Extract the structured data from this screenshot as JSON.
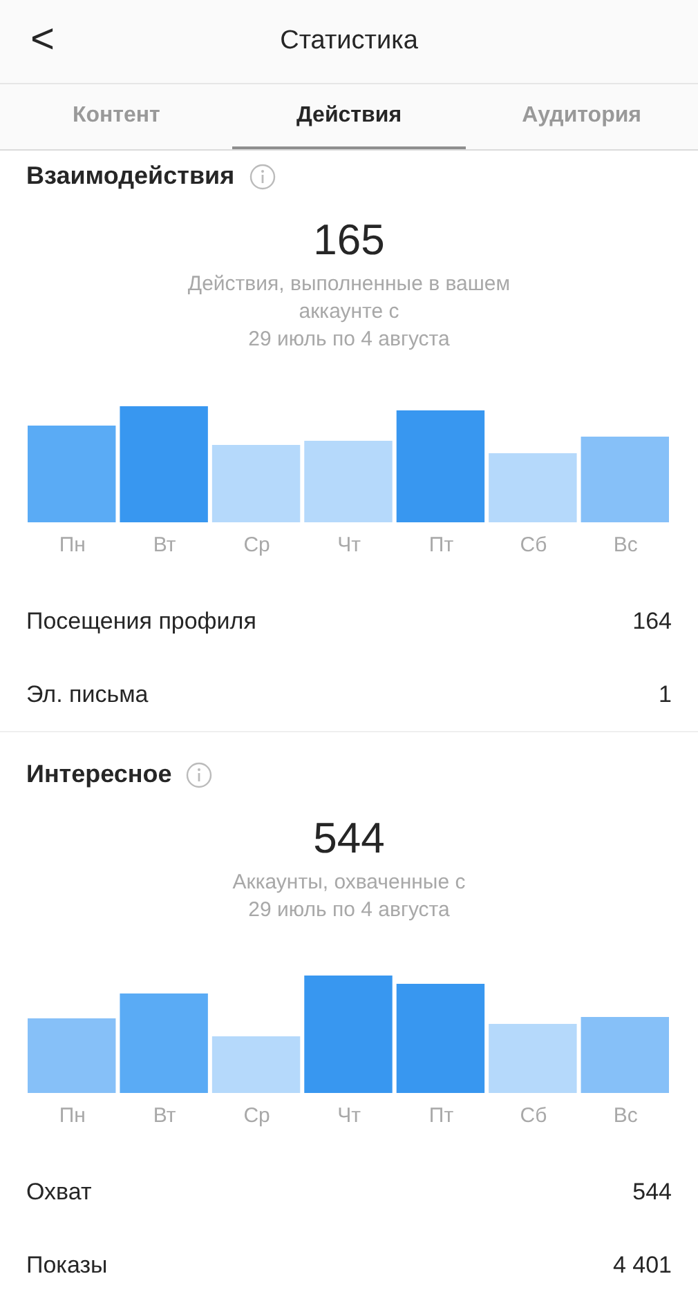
{
  "header": {
    "back": "<",
    "title": "Статистика"
  },
  "tabs": [
    {
      "label": "Контент",
      "selected": false
    },
    {
      "label": "Действия",
      "selected": true
    },
    {
      "label": "Аудитория",
      "selected": false
    }
  ],
  "sections": [
    {
      "title": "Взаимодействия",
      "total": "165",
      "description": [
        "Действия, выполненные в вашем",
        "аккаунте с",
        "29 июль по 4 августа"
      ],
      "days": [
        "Пн",
        "Вт",
        "Ср",
        "Чт",
        "Пт",
        "Сб",
        "Вс"
      ],
      "rows": [
        {
          "label": "Посещения профиля",
          "value": "164"
        },
        {
          "label": "Эл. письма",
          "value": "1"
        }
      ]
    },
    {
      "title": "Интересное",
      "total": "544",
      "description": [
        "Аккаунты, охваченные с",
        "29 июль по 4 августа"
      ],
      "days": [
        "Пн",
        "Вт",
        "Ср",
        "Чт",
        "Пт",
        "Сб",
        "Вс"
      ],
      "rows": [
        {
          "label": "Охват",
          "value": "544"
        },
        {
          "label": "Показы",
          "value": "4 401"
        }
      ]
    }
  ]
}
